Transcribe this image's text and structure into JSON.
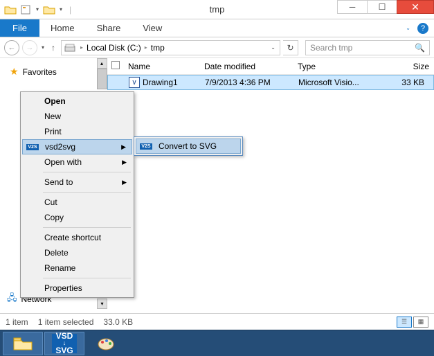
{
  "window": {
    "title": "tmp"
  },
  "ribbon": {
    "file": "File",
    "tabs": [
      "Home",
      "Share",
      "View"
    ]
  },
  "nav": {
    "crumbs": [
      "Local Disk (C:)",
      "tmp"
    ],
    "search_placeholder": "Search tmp"
  },
  "sidebar": {
    "favorites_label": "Favorites",
    "network_label": "Network"
  },
  "columns": {
    "name": "Name",
    "date": "Date modified",
    "type": "Type",
    "size": "Size"
  },
  "files": [
    {
      "name": "Drawing1",
      "date": "7/9/2013 4:36 PM",
      "type": "Microsoft Visio...",
      "size": "33 KB"
    }
  ],
  "status": {
    "count": "1 item",
    "selected": "1 item selected",
    "size": "33.0 KB"
  },
  "context_menu": {
    "open": "Open",
    "new": "New",
    "print": "Print",
    "vsd2svg": "vsd2svg",
    "openwith": "Open with",
    "sendto": "Send to",
    "cut": "Cut",
    "copy": "Copy",
    "shortcut": "Create shortcut",
    "delete": "Delete",
    "rename": "Rename",
    "properties": "Properties"
  },
  "submenu": {
    "convert": "Convert to SVG"
  },
  "icons": {
    "v2s": "V2S",
    "vsd_top": "VSD",
    "vsd_bot": "SVG"
  }
}
